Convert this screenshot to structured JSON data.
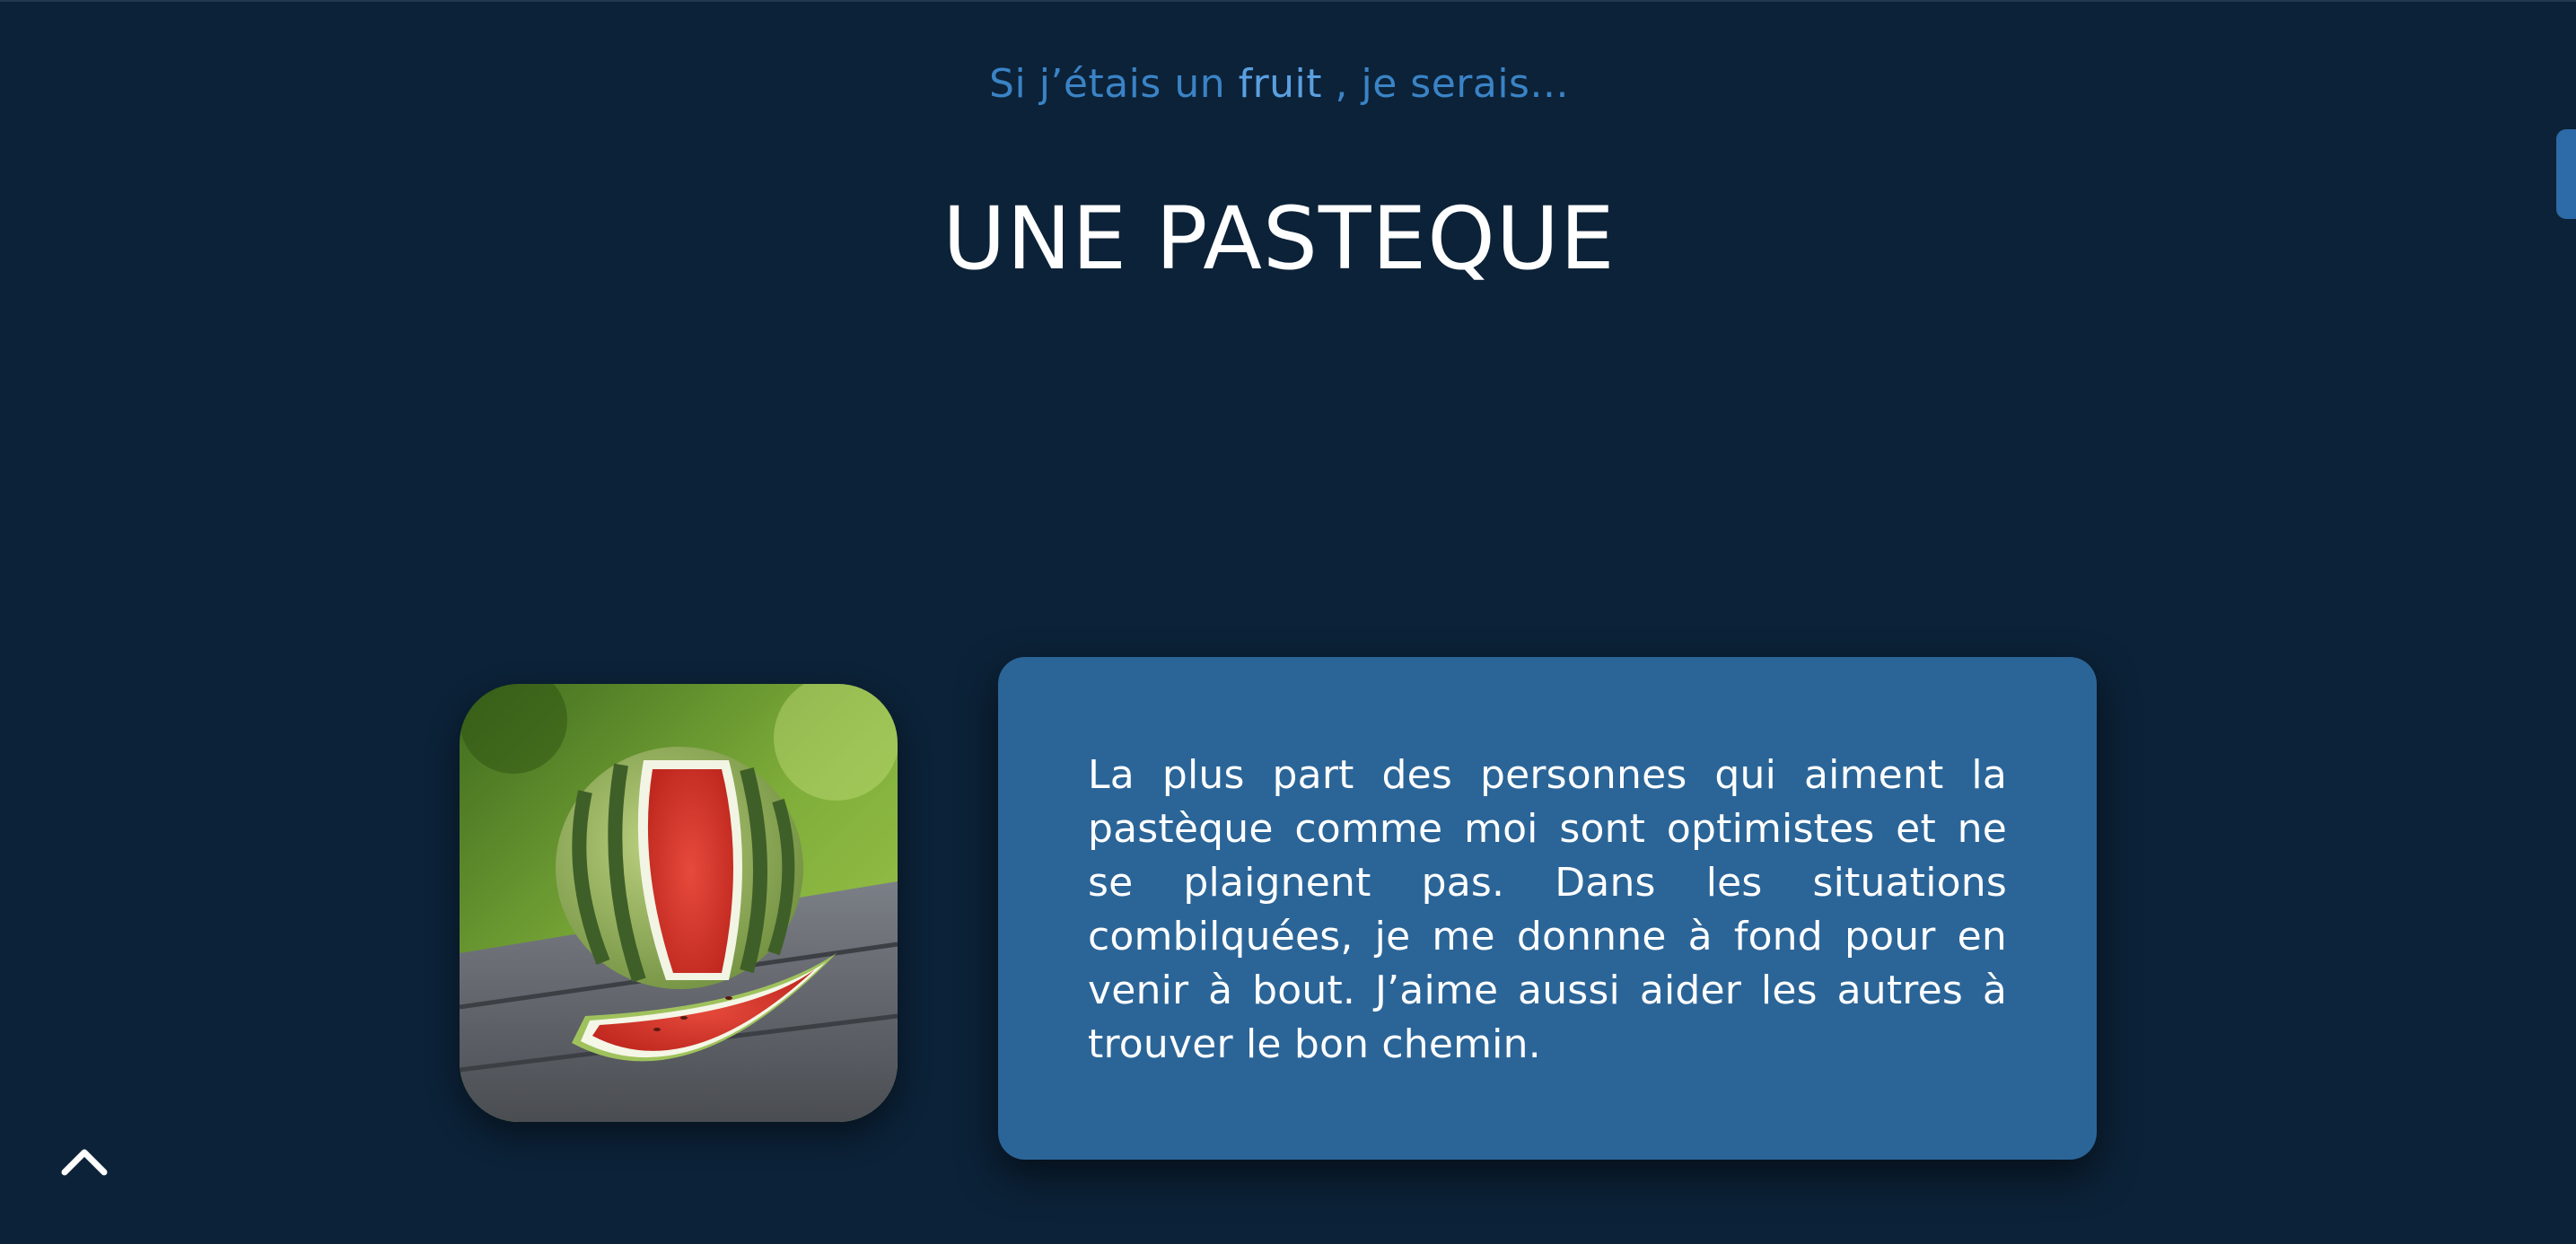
{
  "header": {
    "subtitle_before": "Si j’étais un ",
    "subtitle_highlight": "fruit",
    "subtitle_after": " , je serais...",
    "title": "UNE PASTEQUE"
  },
  "card": {
    "text": "La plus part des personnes qui aiment la pastèque comme moi sont optimistes et ne se plaignent pas. Dans les situations combilquées, je me donnne à fond pour en venir à bout. J’aime aussi aider les autres à trouver le bon chemin."
  },
  "icons": {
    "back_to_top": "chevron-up-icon"
  },
  "colors": {
    "background": "#0c2238",
    "subtitle": "#3a83c6",
    "card": "#2b6598",
    "title": "#ffffff"
  }
}
